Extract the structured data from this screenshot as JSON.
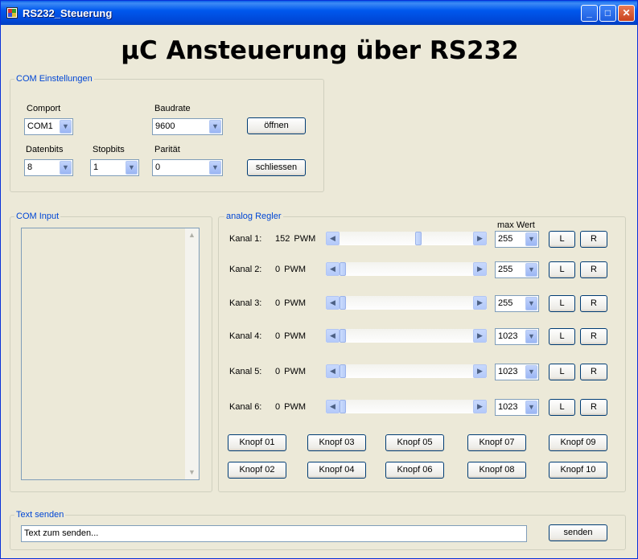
{
  "window": {
    "title": "RS232_Steuerung"
  },
  "heading": "µC Ansteuerung über RS232",
  "com_settings": {
    "group_label": "COM Einstellungen",
    "comport_label": "Comport",
    "comport_value": "COM1",
    "baudrate_label": "Baudrate",
    "baudrate_value": "9600",
    "databits_label": "Datenbits",
    "databits_value": "8",
    "stopbits_label": "Stopbits",
    "stopbits_value": "1",
    "parity_label": "Parität",
    "parity_value": "0",
    "open_label": "öffnen",
    "close_label": "schliessen"
  },
  "com_input": {
    "group_label": "COM Input"
  },
  "analog": {
    "group_label": "analog Regler",
    "max_label": "max Wert",
    "channels": [
      {
        "label": "Kanal 1:",
        "value": "152",
        "unit": "PWM",
        "max": "255",
        "fraction": 0.596,
        "l": "L",
        "r": "R"
      },
      {
        "label": "Kanal 2:",
        "value": "0",
        "unit": "PWM",
        "max": "255",
        "fraction": 0,
        "l": "L",
        "r": "R"
      },
      {
        "label": "Kanal 3:",
        "value": "0",
        "unit": "PWM",
        "max": "255",
        "fraction": 0,
        "l": "L",
        "r": "R"
      },
      {
        "label": "Kanal 4:",
        "value": "0",
        "unit": "PWM",
        "max": "1023",
        "fraction": 0,
        "l": "L",
        "r": "R"
      },
      {
        "label": "Kanal 5:",
        "value": "0",
        "unit": "PWM",
        "max": "1023",
        "fraction": 0,
        "l": "L",
        "r": "R"
      },
      {
        "label": "Kanal 6:",
        "value": "0",
        "unit": "PWM",
        "max": "1023",
        "fraction": 0,
        "l": "L",
        "r": "R"
      }
    ],
    "buttons": [
      "Knopf 01",
      "Knopf 03",
      "Knopf 05",
      "Knopf 07",
      "Knopf 09",
      "Knopf 02",
      "Knopf 04",
      "Knopf 06",
      "Knopf 08",
      "Knopf 10"
    ]
  },
  "text_send": {
    "group_label": "Text senden",
    "input_value": "Text zum senden...",
    "send_label": "senden"
  },
  "icons": {
    "arrow_left": "◀",
    "arrow_right": "▶",
    "dropdown": "▼",
    "scroll_up": "▲",
    "scroll_down": "▼",
    "minimize": "_",
    "maximize": "□",
    "close": "✕"
  },
  "colors": {
    "title_bar": "#0054e3",
    "group_label": "#0046d5",
    "window_bg": "#ece9d8"
  }
}
